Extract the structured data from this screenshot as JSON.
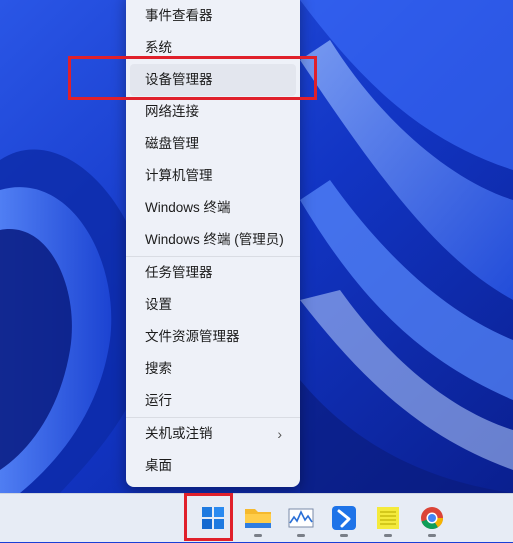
{
  "start_menu": {
    "items": [
      {
        "label": "事件查看器"
      },
      {
        "label": "系统"
      },
      {
        "label": "设备管理器"
      },
      {
        "label": "网络连接"
      },
      {
        "label": "磁盘管理"
      },
      {
        "label": "计算机管理"
      },
      {
        "label": "Windows 终端"
      },
      {
        "label": "Windows 终端 (管理员)"
      },
      {
        "label": "任务管理器"
      },
      {
        "label": "设置"
      },
      {
        "label": "文件资源管理器"
      },
      {
        "label": "搜索"
      },
      {
        "label": "运行"
      },
      {
        "label": "关机或注销"
      },
      {
        "label": "桌面"
      }
    ],
    "submenu_arrow": "›"
  },
  "highlight_color": "#e0202b",
  "taskbar": {
    "icons": [
      "start-icon",
      "file-explorer-icon",
      "performance-monitor-icon",
      "feishu-icon",
      "notepad-icon",
      "chrome-icon"
    ]
  }
}
